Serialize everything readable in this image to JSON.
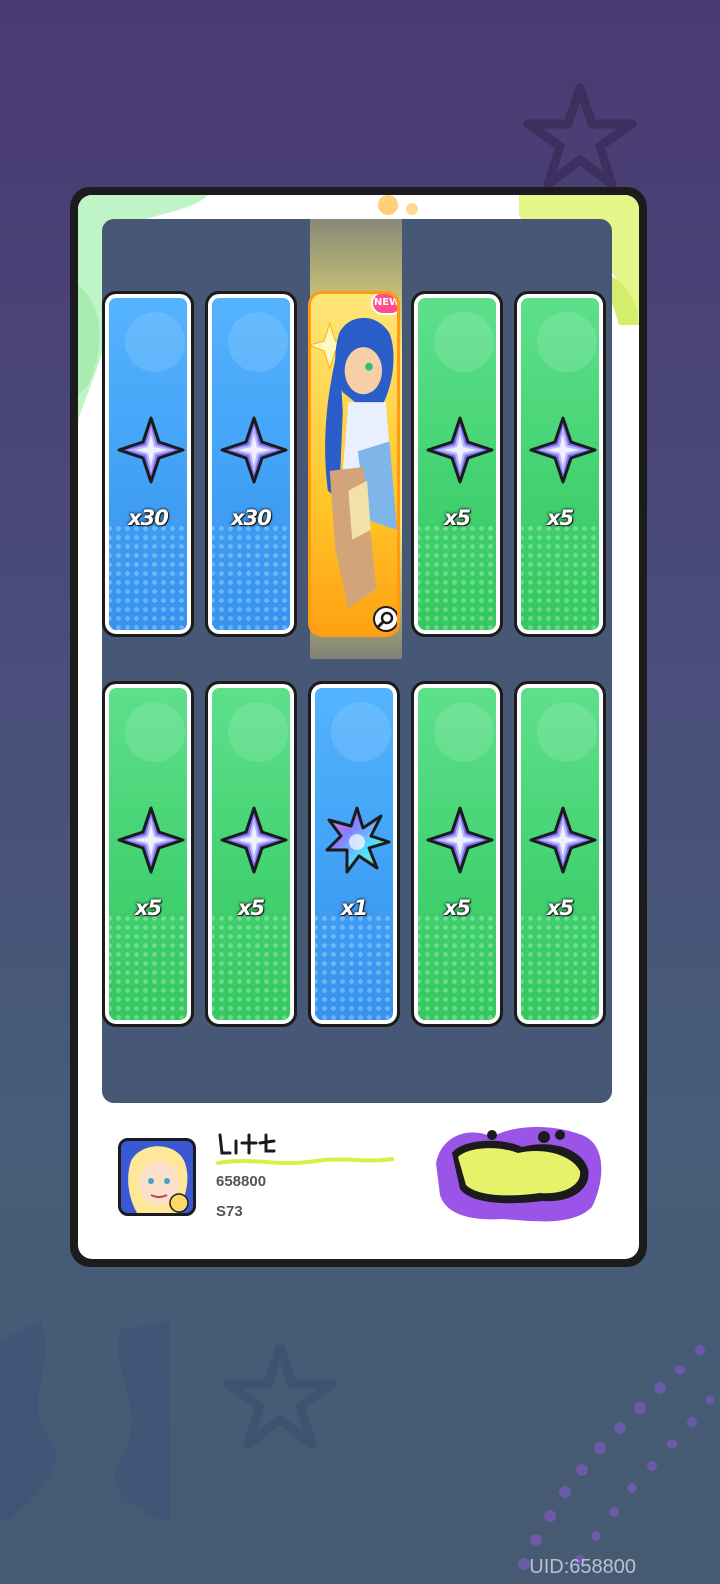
{
  "rewards": {
    "row1": [
      {
        "type": "star-gem",
        "color": "blue",
        "qty": "x30"
      },
      {
        "type": "star-gem",
        "color": "blue",
        "qty": "x30"
      },
      {
        "type": "character",
        "color": "gold",
        "badge": "NEW"
      },
      {
        "type": "star-gem",
        "color": "green",
        "qty": "x5"
      },
      {
        "type": "star-gem",
        "color": "green",
        "qty": "x5"
      }
    ],
    "row2": [
      {
        "type": "star-gem",
        "color": "green",
        "qty": "x5"
      },
      {
        "type": "star-gem",
        "color": "green",
        "qty": "x5"
      },
      {
        "type": "rainbow-gem",
        "color": "blue",
        "qty": "x1"
      },
      {
        "type": "star-gem",
        "color": "green",
        "qty": "x5"
      },
      {
        "type": "star-gem",
        "color": "green",
        "qty": "x5"
      }
    ]
  },
  "player": {
    "name": "",
    "id": "658800",
    "server": "S73"
  },
  "footer": {
    "uid_label": "UID:658800"
  },
  "colors": {
    "blue_tile": "#41a1f5",
    "green_tile": "#43d272",
    "gold_tile": "#ffcb2a",
    "panel": "#475776",
    "gem_purple": "#6a5bd6"
  }
}
